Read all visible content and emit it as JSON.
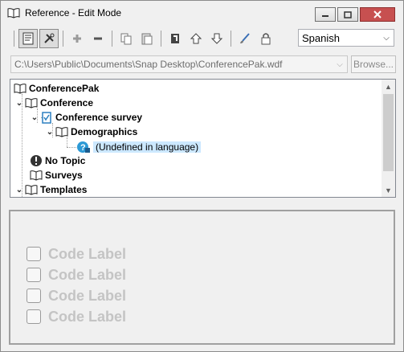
{
  "window": {
    "title": "Reference - Edit Mode"
  },
  "toolbar": {
    "language": "Spanish"
  },
  "path": {
    "value": "C:\\Users\\Public\\Documents\\Snap Desktop\\ConferencePak.wdf",
    "browse_label": "Browse..."
  },
  "tree": {
    "items": [
      {
        "label": "ConferencePak",
        "icon": "book-open-icon"
      },
      {
        "label": "Conference",
        "icon": "book-open-icon"
      },
      {
        "label": "Conference survey",
        "icon": "survey-clipboard-icon"
      },
      {
        "label": "Demographics",
        "icon": "book-open-icon"
      },
      {
        "label": "(Undefined in language)",
        "icon": "undefined-question-icon"
      },
      {
        "label": "No Topic",
        "icon": "exclamation-icon"
      },
      {
        "label": "Surveys",
        "icon": "book-open-icon"
      },
      {
        "label": "Templates",
        "icon": "book-open-icon"
      }
    ]
  },
  "codes": {
    "items": [
      {
        "label": "Code Label"
      },
      {
        "label": "Code Label"
      },
      {
        "label": "Code Label"
      },
      {
        "label": "Code Label"
      }
    ]
  },
  "colors": {
    "selection": "#cce8ff",
    "disabled_text": "#c4c4c4",
    "close_button": "#c75050"
  }
}
